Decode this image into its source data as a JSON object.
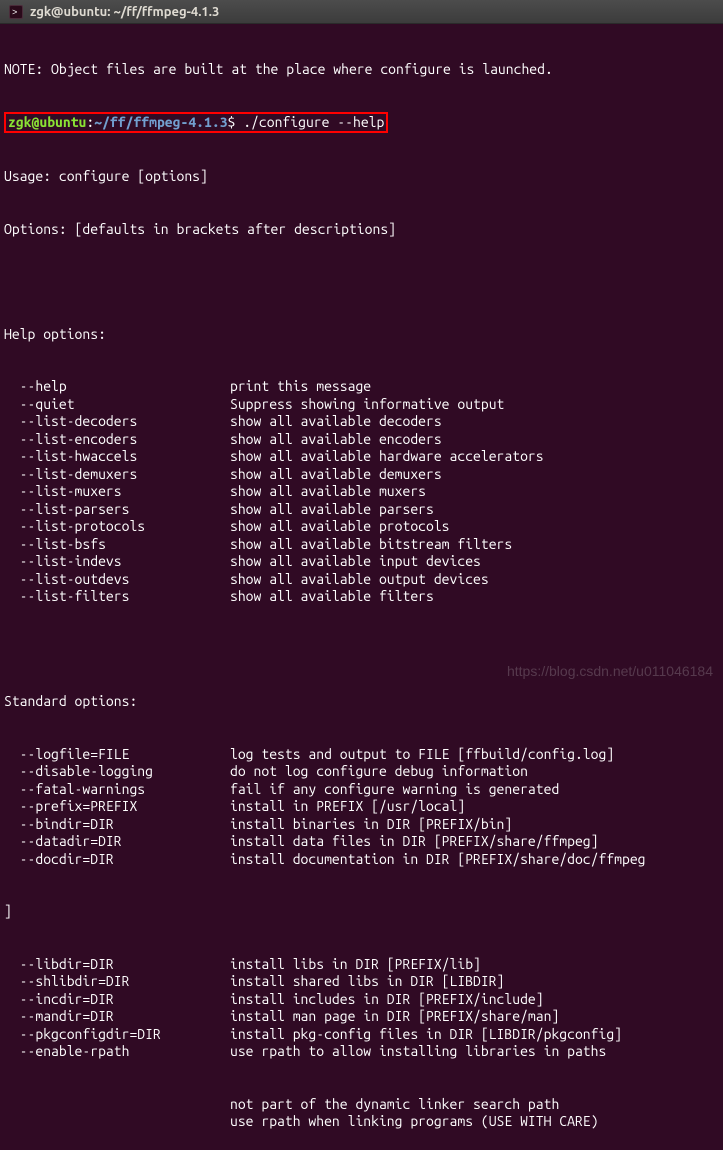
{
  "window": {
    "title": "zgk@ubuntu: ~/ff/ffmpeg-4.1.3"
  },
  "note_line": "NOTE: Object files are built at the place where configure is launched.",
  "prompt": {
    "user_host": "zgk@ubuntu",
    "colon": ":",
    "path": "~/ff/ffmpeg-4.1.3",
    "dollar": "$ ",
    "command": "./configure --help"
  },
  "usage": "Usage: configure [options]",
  "options_hint": "Options: [defaults in brackets after descriptions]",
  "help_section": "Help options:",
  "help_options": [
    {
      "flag": "  --help",
      "desc": "print this message"
    },
    {
      "flag": "  --quiet",
      "desc": "Suppress showing informative output"
    },
    {
      "flag": "  --list-decoders",
      "desc": "show all available decoders"
    },
    {
      "flag": "  --list-encoders",
      "desc": "show all available encoders"
    },
    {
      "flag": "  --list-hwaccels",
      "desc": "show all available hardware accelerators"
    },
    {
      "flag": "  --list-demuxers",
      "desc": "show all available demuxers"
    },
    {
      "flag": "  --list-muxers",
      "desc": "show all available muxers"
    },
    {
      "flag": "  --list-parsers",
      "desc": "show all available parsers"
    },
    {
      "flag": "  --list-protocols",
      "desc": "show all available protocols"
    },
    {
      "flag": "  --list-bsfs",
      "desc": "show all available bitstream filters"
    },
    {
      "flag": "  --list-indevs",
      "desc": "show all available input devices"
    },
    {
      "flag": "  --list-outdevs",
      "desc": "show all available output devices"
    },
    {
      "flag": "  --list-filters",
      "desc": "show all available filters"
    }
  ],
  "standard_section": "Standard options:",
  "standard_options": [
    {
      "flag": "  --logfile=FILE",
      "desc": "log tests and output to FILE [ffbuild/config.log]"
    },
    {
      "flag": "  --disable-logging",
      "desc": "do not log configure debug information"
    },
    {
      "flag": "  --fatal-warnings",
      "desc": "fail if any configure warning is generated"
    },
    {
      "flag": "  --prefix=PREFIX",
      "desc": "install in PREFIX [/usr/local]"
    },
    {
      "flag": "  --bindir=DIR",
      "desc": "install binaries in DIR [PREFIX/bin]"
    },
    {
      "flag": "  --datadir=DIR",
      "desc": "install data files in DIR [PREFIX/share/ffmpeg]"
    },
    {
      "flag": "  --docdir=DIR",
      "desc": "install documentation in DIR [PREFIX/share/doc/ffmpeg"
    }
  ],
  "bracket_line": "]",
  "standard_options_2": [
    {
      "flag": "  --libdir=DIR",
      "desc": "install libs in DIR [PREFIX/lib]"
    },
    {
      "flag": "  --shlibdir=DIR",
      "desc": "install shared libs in DIR [LIBDIR]"
    },
    {
      "flag": "  --incdir=DIR",
      "desc": "install includes in DIR [PREFIX/include]"
    },
    {
      "flag": "  --mandir=DIR",
      "desc": "install man page in DIR [PREFIX/share/man]"
    },
    {
      "flag": "  --pkgconfigdir=DIR",
      "desc": "install pkg-config files in DIR [LIBDIR/pkgconfig]"
    },
    {
      "flag": "  --enable-rpath",
      "desc": "use rpath to allow installing libraries in paths"
    }
  ],
  "continuation_lines": [
    {
      "flag": "",
      "desc": "not part of the dynamic linker search path"
    },
    {
      "flag": "",
      "desc": "use rpath when linking programs (USE WITH CARE)"
    }
  ],
  "watermark": "https://blog.csdn.net/u011046184"
}
